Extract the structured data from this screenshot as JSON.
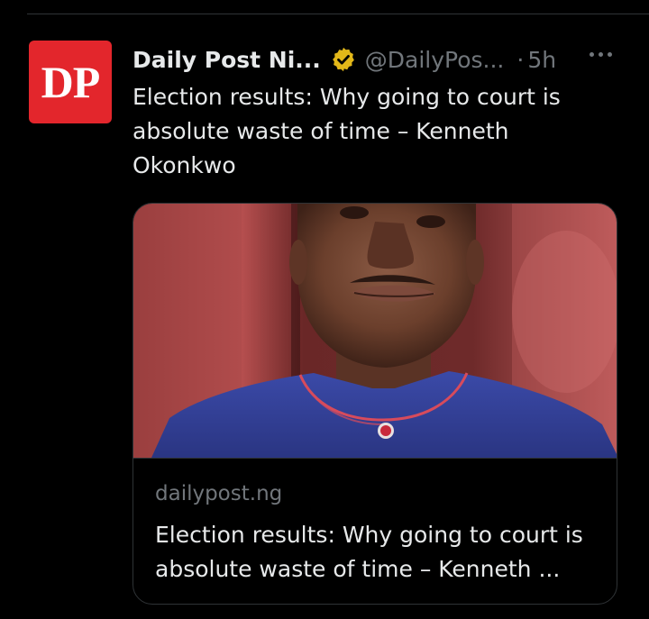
{
  "tweet": {
    "avatar_text": "DP",
    "display_name": "Daily Post Ni...",
    "handle": "@DailyPos...",
    "separator": "·",
    "time": "5h",
    "text": "Election results: Why going to court is absolute waste of time – Kenneth Okonkwo",
    "verified_icon": "verified-badge-gold"
  },
  "card": {
    "domain": "dailypost.ng",
    "title": "Election results: Why going to court is absolute waste of time – Kenneth ..."
  },
  "colors": {
    "background": "#000000",
    "avatar_red": "#e3262c",
    "verified_gold": "#e2b719",
    "text_primary": "#e7e9ea",
    "text_secondary": "#71767b",
    "border": "#2f3336"
  }
}
